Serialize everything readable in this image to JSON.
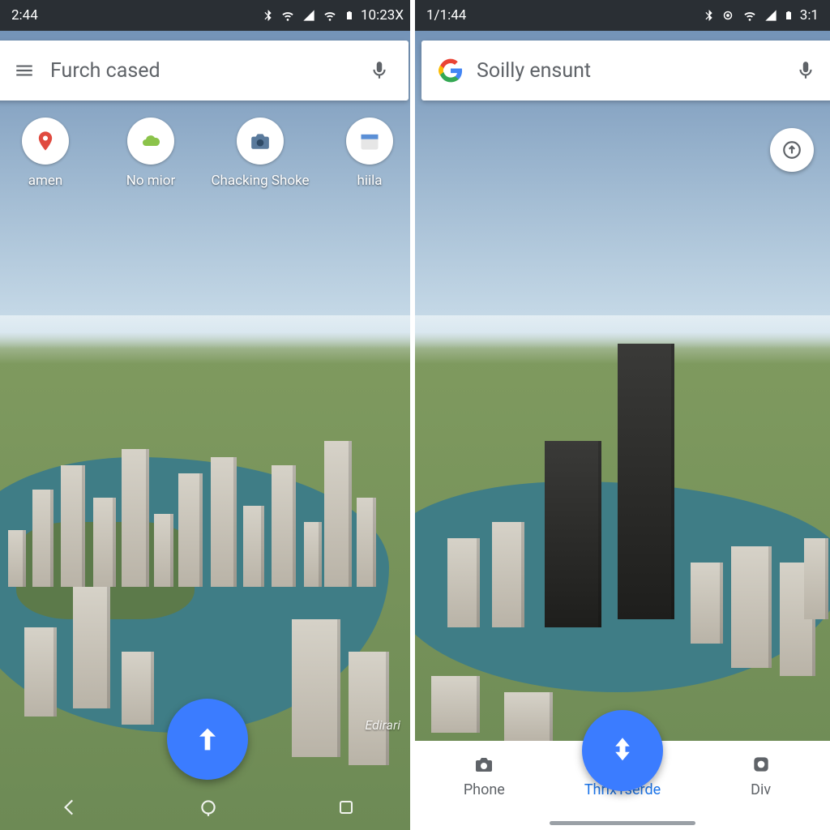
{
  "left": {
    "status": {
      "time": "2:44",
      "right_text": "10:23X"
    },
    "search": {
      "value": "Furch cased"
    },
    "chips": [
      {
        "icon": "pin-icon",
        "label": "amen"
      },
      {
        "icon": "cloud-icon",
        "label": "No mior"
      },
      {
        "icon": "camera-icon",
        "label": "Chacking Shoke"
      },
      {
        "icon": "calendar-icon",
        "label": "hiila"
      }
    ],
    "watermark": "Edirari"
  },
  "right": {
    "status": {
      "time": "1/1:44",
      "right_text": "3:1"
    },
    "search": {
      "value": "Soilly ensunt"
    },
    "tabs": [
      {
        "icon": "camera-icon",
        "label": "Phone",
        "active": false
      },
      {
        "icon": "nav-icon",
        "label": "ThrïxTserde",
        "active": true
      },
      {
        "icon": "lens-icon",
        "label": "Div",
        "active": false
      }
    ]
  }
}
